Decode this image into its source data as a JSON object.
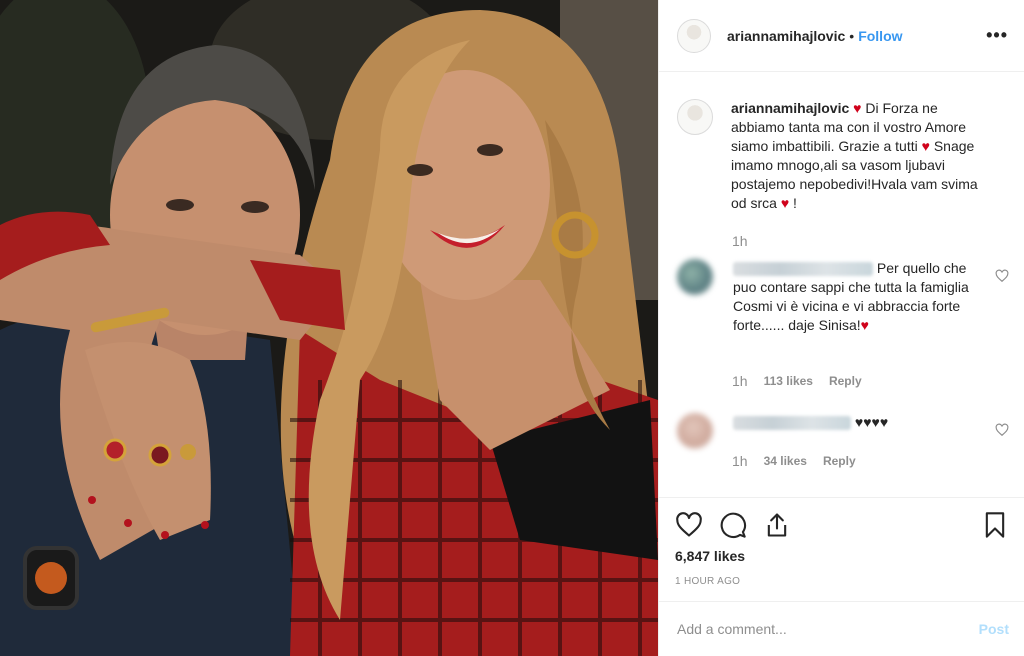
{
  "header": {
    "username": "ariannamihajlovic",
    "separator": "•",
    "follow_label": "Follow",
    "more_label": "•••"
  },
  "caption": {
    "username": "ariannamihajlovic",
    "text_1": " Di Forza ne abbiamo tanta ma con il vostro Amore siamo imbattibili. Grazie a tutti ",
    "text_2": " Snage imamo mnogo,ali sa vasom ljubavi postajemo nepobedivi!Hvala vam svima od srca ",
    "text_3": "!",
    "heart": "♥",
    "time": "1h"
  },
  "comments": [
    {
      "text": "Per quello che puo contare sappi che tutta la famiglia Cosmi vi è vicina e vi abbraccia forte forte...... daje Sinisa!",
      "heart": "♥",
      "time": "1h",
      "likes": "113 likes",
      "reply": "Reply"
    },
    {
      "text": "♥♥♥♥",
      "time": "1h",
      "likes": "34 likes",
      "reply": "Reply"
    }
  ],
  "actions": {
    "icons": [
      "heart-outline-icon",
      "comment-icon",
      "share-icon",
      "bookmark-icon"
    ],
    "likes": "6,847 likes",
    "time": "1 HOUR AGO"
  },
  "add_comment": {
    "placeholder": "Add a comment...",
    "post_label": "Post"
  },
  "colors": {
    "link": "#3897f0",
    "heart": "#d0021b",
    "muted": "#8e8e8e",
    "post_disabled": "#b2dffc"
  }
}
